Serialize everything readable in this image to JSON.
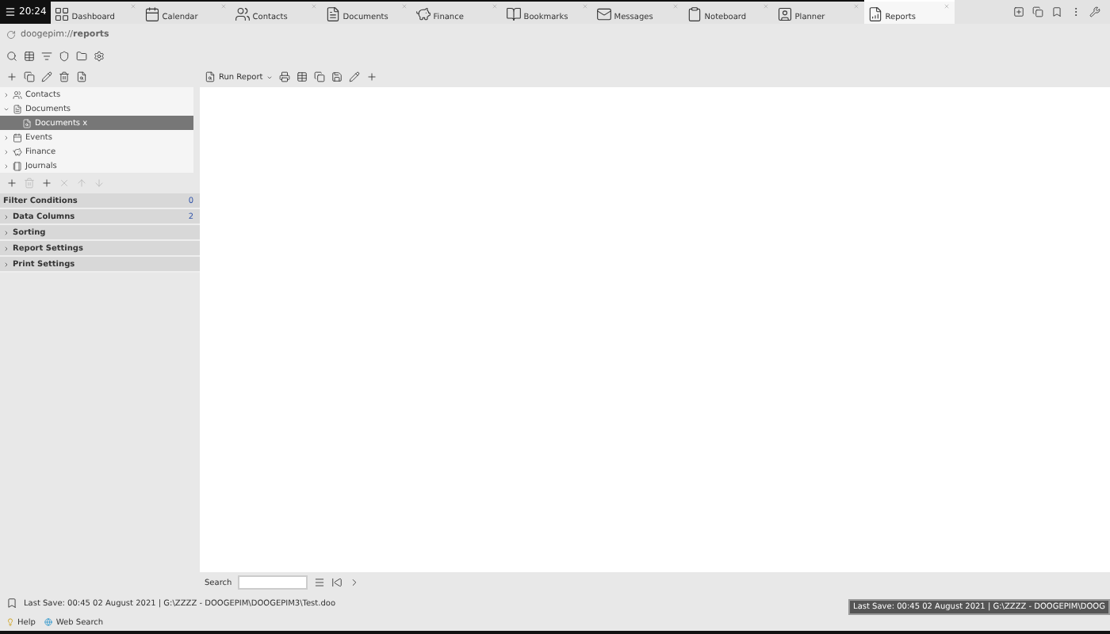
{
  "clock": "20:24",
  "tabs": [
    {
      "label": "Dashboard",
      "selected": false
    },
    {
      "label": "Calendar",
      "selected": false
    },
    {
      "label": "Contacts",
      "selected": false
    },
    {
      "label": "Documents",
      "selected": false
    },
    {
      "label": "Finance",
      "selected": false
    },
    {
      "label": "Bookmarks",
      "selected": false
    },
    {
      "label": "Messages",
      "selected": false
    },
    {
      "label": "Noteboard",
      "selected": false
    },
    {
      "label": "Planner",
      "selected": false
    },
    {
      "label": "Reports",
      "selected": true
    }
  ],
  "address": "doogepim://**reports**",
  "tree": [
    {
      "label": "Contacts",
      "expanded": false,
      "selected": false
    },
    {
      "label": "Documents",
      "expanded": true,
      "selected": false,
      "children": [
        {
          "label": "Documents x",
          "selected": true
        }
      ]
    },
    {
      "label": "Events",
      "expanded": false,
      "selected": false
    },
    {
      "label": "Finance",
      "expanded": false,
      "selected": false
    },
    {
      "label": "Journals",
      "expanded": false,
      "selected": false
    }
  ],
  "sections": [
    {
      "label": "Filter Conditions",
      "count": "0",
      "expanded": true
    },
    {
      "label": "Data Columns",
      "count": "2",
      "expanded": false
    },
    {
      "label": "Sorting",
      "expanded": false
    },
    {
      "label": "Report Settings",
      "expanded": false
    },
    {
      "label": "Print Settings",
      "expanded": false
    }
  ],
  "run_report": "Run Report",
  "search": {
    "label": "Search"
  },
  "status": "Last Save: 00:45 02 August 2021 | G:\\ZZZZ - DOOGEPIM\\DOOGEPIM3\\Test.doo",
  "tooltip": "Last Save: 00:45 02 August 2021 | G:\\ZZZZ - DOOGEPIM\\DOOG",
  "footer_links": [
    "Help",
    "Web Search"
  ]
}
